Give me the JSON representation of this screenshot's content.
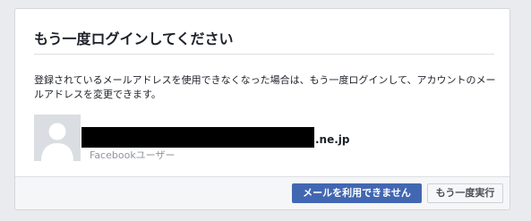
{
  "dialog": {
    "title": "もう一度ログインしてください",
    "message": "登録されているメールアドレスを使用できなくなった場合は、もう一度ログインして、アカウントのメールアドレスを変更できます。",
    "account": {
      "email_visible_suffix": ".ne.jp",
      "subtitle": "Facebookユーザー",
      "avatar_icon": "default-profile-silhouette"
    },
    "buttons": {
      "primary_label": "メールを利用できません",
      "secondary_label": "もう一度実行"
    }
  },
  "colors": {
    "primary_button": "#4267b2",
    "page_background": "#e9ebee",
    "footer_background": "#f5f6f7"
  }
}
